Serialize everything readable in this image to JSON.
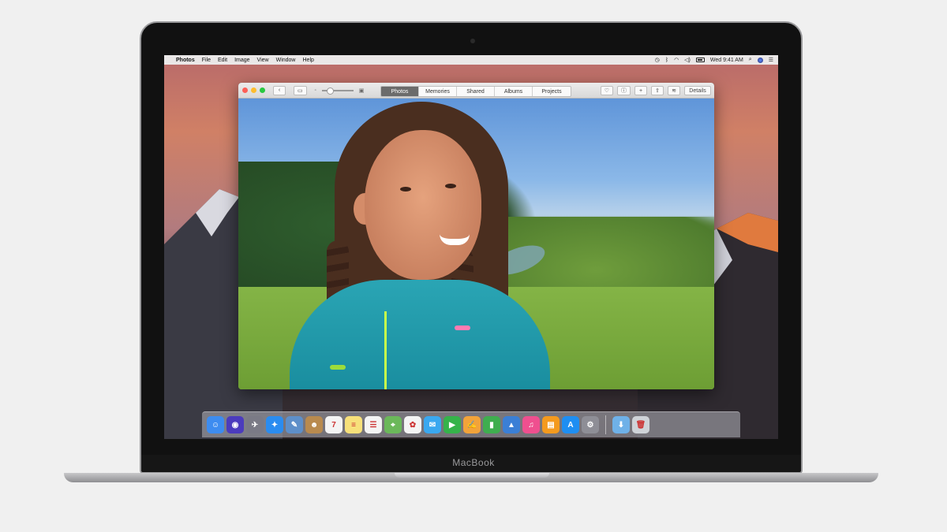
{
  "menubar": {
    "app_name": "Photos",
    "menus": [
      "File",
      "Edit",
      "Image",
      "View",
      "Window",
      "Help"
    ],
    "clock": "Wed 9:41 AM"
  },
  "window": {
    "nav": {
      "back_icon": "chevron-left-icon",
      "zoom_label": ""
    },
    "tabs": [
      {
        "label": "Photos",
        "active": true
      },
      {
        "label": "Memories",
        "active": false
      },
      {
        "label": "Shared",
        "active": false
      },
      {
        "label": "Albums",
        "active": false
      },
      {
        "label": "Projects",
        "active": false
      }
    ],
    "tools": {
      "details_label": "Details"
    }
  },
  "dock": {
    "apps": [
      {
        "name": "finder",
        "color": "#3d8cf0",
        "glyph": "☺"
      },
      {
        "name": "siri",
        "color": "#4b3bbd",
        "glyph": "◉"
      },
      {
        "name": "launchpad",
        "color": "#7a7a86",
        "glyph": "✈"
      },
      {
        "name": "safari",
        "color": "#2a8cf0",
        "glyph": "✦"
      },
      {
        "name": "preview",
        "color": "#5e8fc9",
        "glyph": "✎"
      },
      {
        "name": "contacts",
        "color": "#b98a4e",
        "glyph": "☻"
      },
      {
        "name": "calendar",
        "color": "#f4f4f4",
        "glyph": "7"
      },
      {
        "name": "notes",
        "color": "#f7e07a",
        "glyph": "≡"
      },
      {
        "name": "reminders",
        "color": "#f4f4f4",
        "glyph": "☰"
      },
      {
        "name": "maps",
        "color": "#6bb85a",
        "glyph": "⌖"
      },
      {
        "name": "photos",
        "color": "#f4f4f4",
        "glyph": "✿"
      },
      {
        "name": "messages",
        "color": "#3aa8f0",
        "glyph": "✉"
      },
      {
        "name": "facetime",
        "color": "#35b34a",
        "glyph": "▶"
      },
      {
        "name": "pages",
        "color": "#f2a33a",
        "glyph": "✍"
      },
      {
        "name": "numbers",
        "color": "#3fae4f",
        "glyph": "▮"
      },
      {
        "name": "keynote",
        "color": "#3b7fd6",
        "glyph": "▲"
      },
      {
        "name": "itunes",
        "color": "#ef4f8f",
        "glyph": "♫"
      },
      {
        "name": "ibooks",
        "color": "#f49a1e",
        "glyph": "▤"
      },
      {
        "name": "app-store",
        "color": "#1e8ef2",
        "glyph": "A"
      },
      {
        "name": "system-preferences",
        "color": "#8e8e96",
        "glyph": "⚙"
      }
    ],
    "folders": [
      {
        "name": "downloads",
        "color": "#6fb1e8",
        "glyph": "⬇"
      },
      {
        "name": "trash",
        "color": "#cfd3d8",
        "glyph": "🗑"
      }
    ]
  },
  "device": {
    "brand": "MacBook"
  }
}
